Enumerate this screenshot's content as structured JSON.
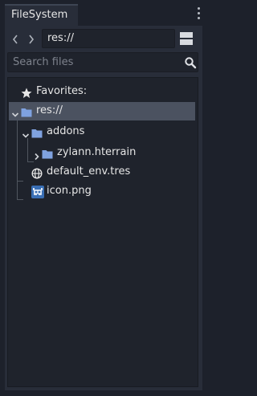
{
  "tab": {
    "label": "FileSystem"
  },
  "path": {
    "value": "res://"
  },
  "search": {
    "placeholder": "Search files"
  },
  "tree": {
    "favorites_label": "Favorites:",
    "root_label": "res://",
    "addons_label": "addons",
    "zylann_label": "zylann.hterrain",
    "default_env_label": "default_env.tres",
    "icon_label": "icon.png"
  },
  "colors": {
    "folder": "#7fa2e0",
    "selection": "#4b5260",
    "background": "#1d212b",
    "panel": "#282d39"
  }
}
